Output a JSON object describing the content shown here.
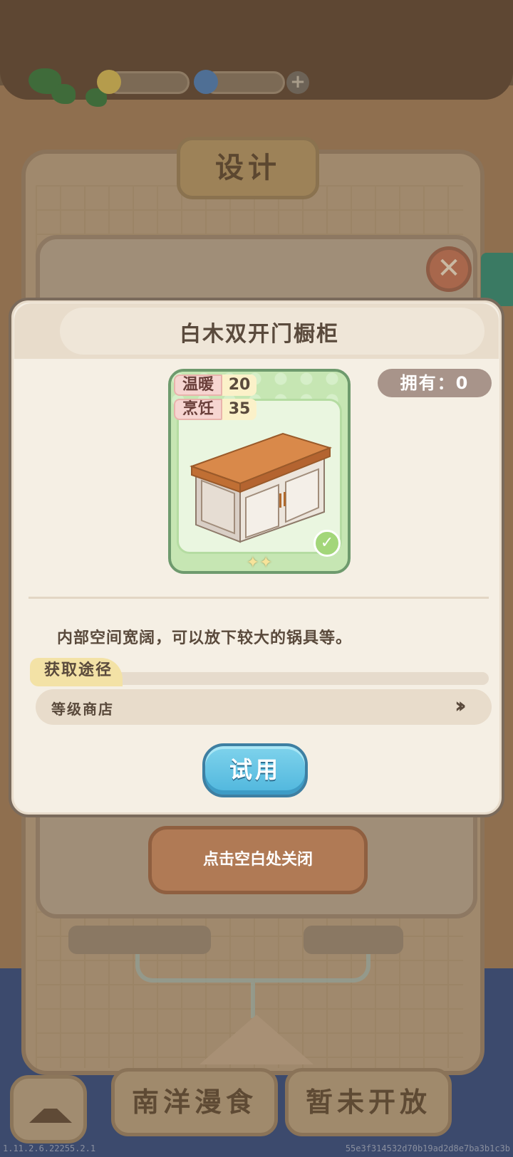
{
  "background": {
    "design_tab": "设计",
    "close_hint": "点击空白处关闭",
    "bottom_tabs": [
      "南洋漫食",
      "暂未开放"
    ]
  },
  "modal": {
    "title": "白木双开门橱柜",
    "owned": "拥有：0",
    "stats": [
      {
        "name": "温暖",
        "value": "20"
      },
      {
        "name": "烹饪",
        "value": "35"
      }
    ],
    "rarity_stars": 2,
    "description": "内部空间宽阔，可以放下较大的锅具等。",
    "source_header": "获取途径",
    "sources": [
      "等级商店"
    ],
    "try_button": "试用"
  },
  "footer": {
    "version": "1.11.2.6.22255.2.1",
    "build_hash": "55e3f314532d70b19ad2d8e7ba3b1c3b"
  },
  "colors": {
    "modal_bg": "#f5efe4",
    "card_green": "#c6e6b3",
    "try_button": "#4fb6dd",
    "owned_pill": "#a8948a"
  }
}
